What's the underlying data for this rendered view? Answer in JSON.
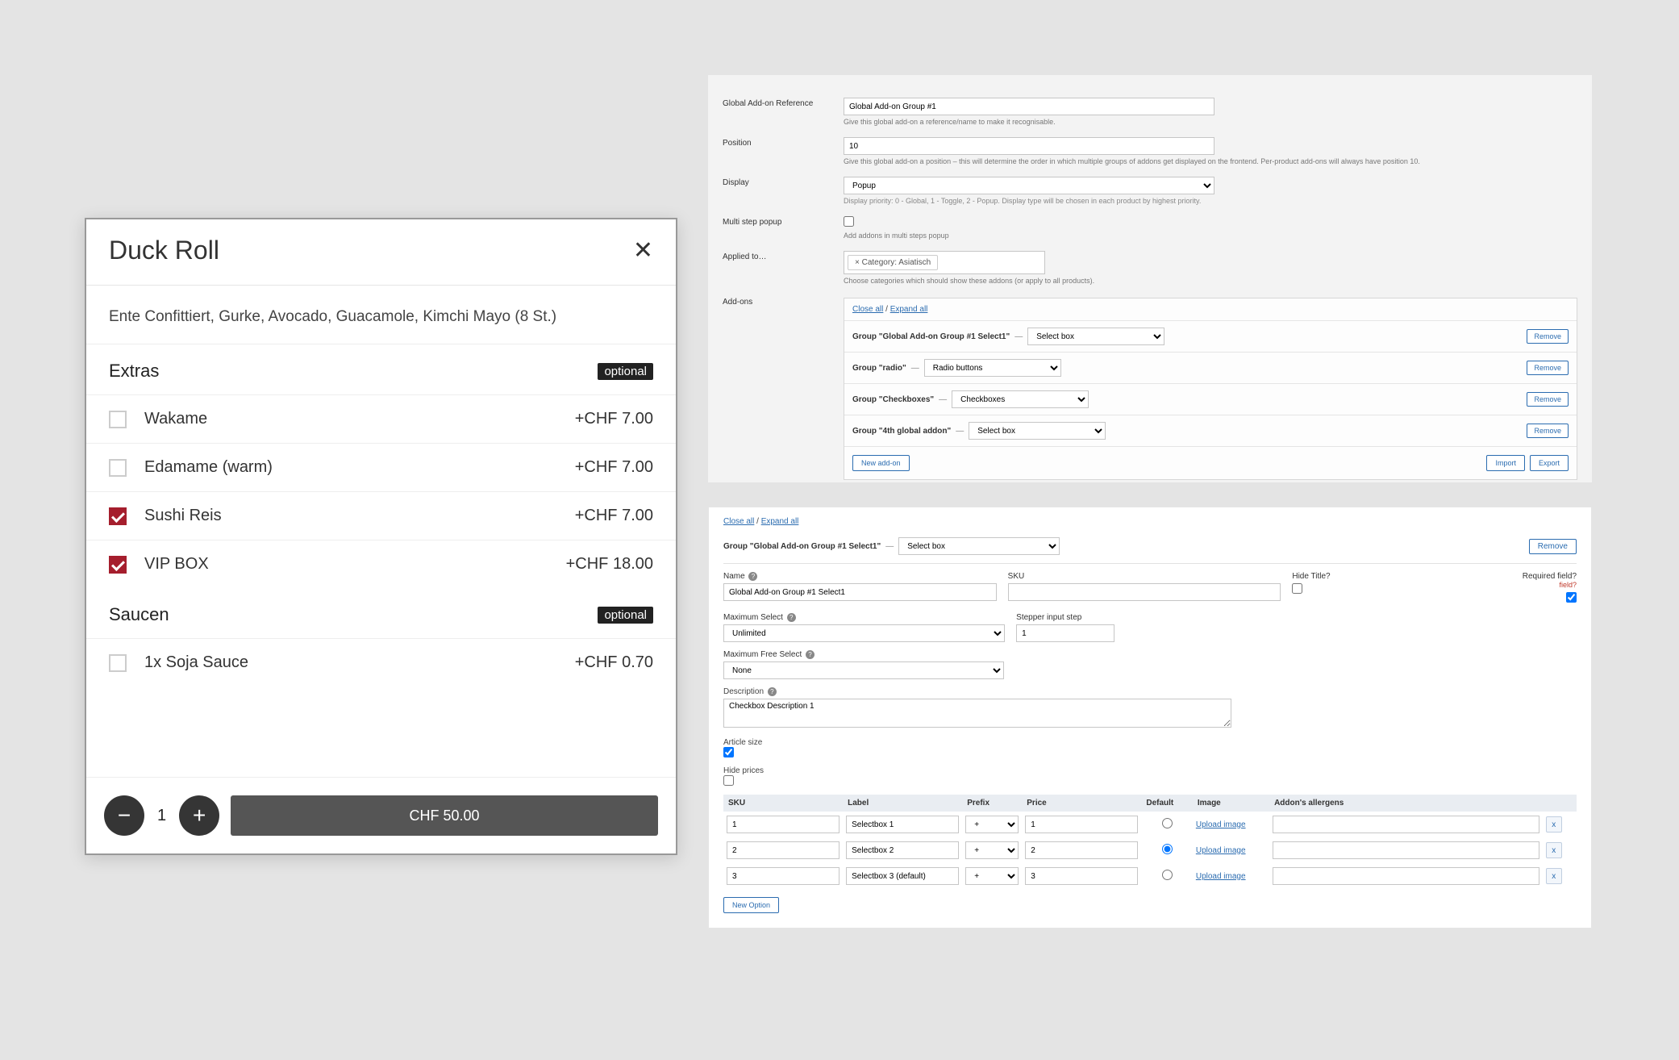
{
  "popup": {
    "title": "Duck Roll",
    "description": "Ente Confittiert, Gurke, Avocado, Guacamole, Kimchi Mayo (8 St.)",
    "sections": [
      {
        "title": "Extras",
        "badge": "optional",
        "items": [
          {
            "label": "Wakame",
            "price": "+CHF 7.00",
            "checked": false
          },
          {
            "label": "Edamame (warm)",
            "price": "+CHF 7.00",
            "checked": false
          },
          {
            "label": "Sushi Reis",
            "price": "+CHF 7.00",
            "checked": true
          },
          {
            "label": "VIP BOX",
            "price": "+CHF 18.00",
            "checked": true
          }
        ]
      },
      {
        "title": "Saucen",
        "badge": "optional",
        "items": [
          {
            "label": "1x Soja Sauce",
            "price": "+CHF 0.70",
            "checked": false
          }
        ]
      }
    ],
    "quantity": "1",
    "button_price": "CHF 50.00"
  },
  "adminA": {
    "ref_label": "Global Add-on Reference",
    "ref_value": "Global Add-on Group #1",
    "ref_help": "Give this global add-on a reference/name to make it recognisable.",
    "pos_label": "Position",
    "pos_value": "10",
    "pos_help": "Give this global add-on a position – this will determine the order in which multiple groups of addons get displayed on the frontend. Per-product add-ons will always have position 10.",
    "disp_label": "Display",
    "disp_value": "Popup",
    "disp_help": "Display priority: 0 - Global, 1 - Toggle, 2 - Popup. Display type will be chosen in each product by highest priority.",
    "multi_label": "Multi step popup",
    "multi_help": "Add addons in multi steps popup",
    "applied_label": "Applied to…",
    "applied_chip": "× Category: Asiatisch",
    "applied_help": "Choose categories which should show these addons (or apply to all products).",
    "addons_label": "Add-ons",
    "close_all": "Close all",
    "expand_all": "Expand all",
    "groups": [
      {
        "name": "Group \"Global Add-on Group #1 Select1\"",
        "select": "Select box"
      },
      {
        "name": "Group \"radio\"",
        "select": "Radio buttons"
      },
      {
        "name": "Group \"Checkboxes\"",
        "select": "Checkboxes"
      },
      {
        "name": "Group \"4th global addon\"",
        "select": "Select box"
      }
    ],
    "remove": "Remove",
    "new_addon": "New add-on",
    "import": "Import",
    "export": "Export"
  },
  "adminB": {
    "close_all": "Close all",
    "expand_all": "Expand all",
    "group_name": "Group \"Global Add-on Group #1 Select1\"",
    "group_select": "Select box",
    "remove": "Remove",
    "name_label": "Name",
    "name_value": "Global Add-on Group #1 Select1",
    "sku_label": "SKU",
    "hide_label": "Hide Title?",
    "req_label": "Required field?",
    "max_label": "Maximum Select",
    "max_value": "Unlimited",
    "step_label": "Stepper input step",
    "step_value": "1",
    "maxfree_label": "Maximum Free Select",
    "maxfree_value": "None",
    "desc_label": "Description",
    "desc_value": "Checkbox Description 1",
    "artsize_label": "Article size",
    "hideprice_label": "Hide prices",
    "th_sku": "SKU",
    "th_label": "Label",
    "th_prefix": "Prefix",
    "th_price": "Price",
    "th_default": "Default",
    "th_image": "Image",
    "th_allerg": "Addon's allergens",
    "rows": [
      {
        "sku": "1",
        "label": "Selectbox 1",
        "prefix": "+",
        "price": "1",
        "default": false,
        "image": "Upload image"
      },
      {
        "sku": "2",
        "label": "Selectbox 2",
        "prefix": "+",
        "price": "2",
        "default": true,
        "image": "Upload image"
      },
      {
        "sku": "3",
        "label": "Selectbox 3 (default)",
        "prefix": "+",
        "price": "3",
        "default": false,
        "image": "Upload image"
      }
    ],
    "new_option": "New Option"
  }
}
